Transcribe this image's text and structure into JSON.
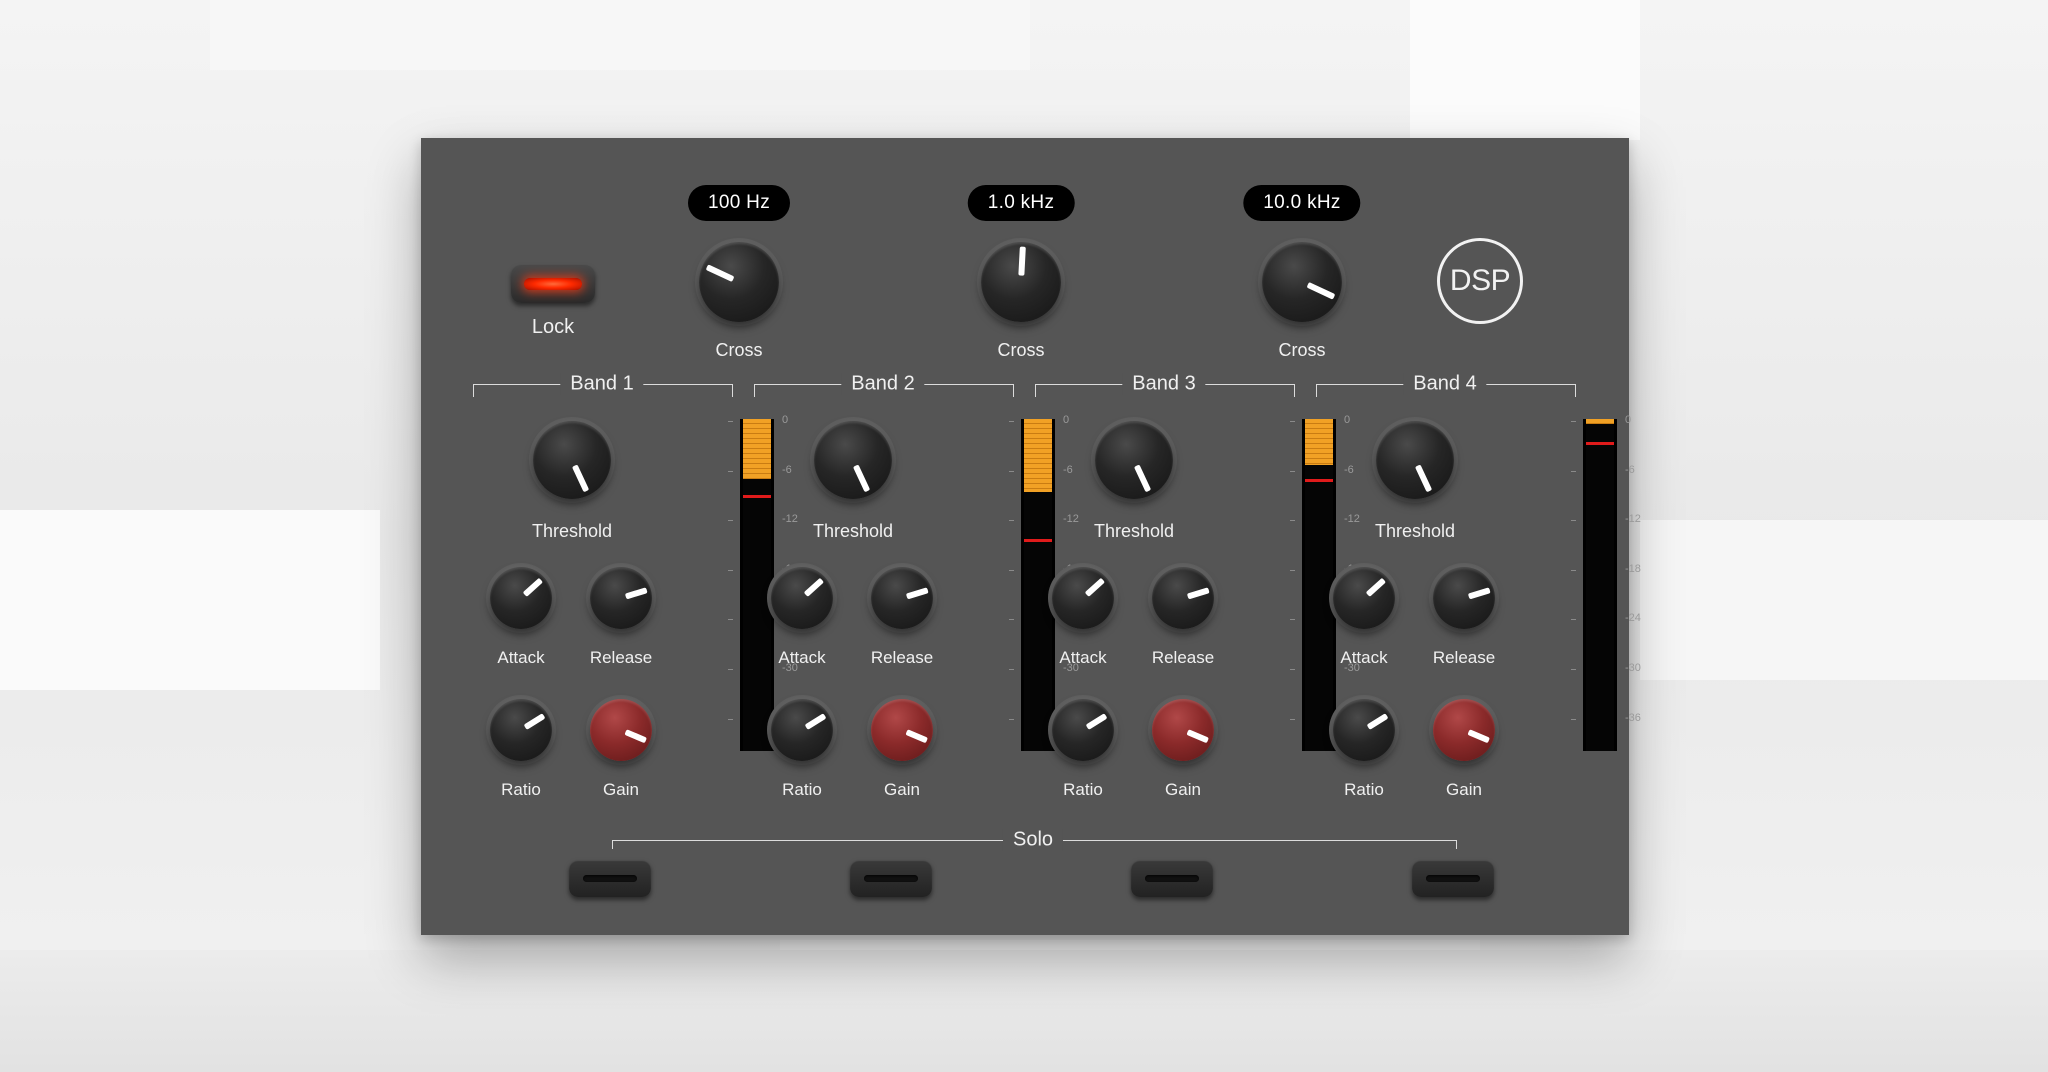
{
  "cross": [
    {
      "label": "Cross",
      "value": "100 Hz",
      "angle": -65
    },
    {
      "label": "Cross",
      "value": "1.0 kHz",
      "angle": 3
    },
    {
      "label": "Cross",
      "value": "10.0 kHz",
      "angle": 115
    }
  ],
  "lock": {
    "label": "Lock",
    "state": "on"
  },
  "logo": {
    "text": "DSP"
  },
  "meter_scale": [
    "0",
    "-6",
    "-12",
    "-18",
    "-24",
    "-30",
    "-36"
  ],
  "bands": [
    {
      "title": "Band 1",
      "threshold": "Threshold",
      "attack": "Attack",
      "release": "Release",
      "ratio": "Ratio",
      "gain": "Gain",
      "threshold_angle": 155,
      "attack_angle": 48,
      "release_angle": 73,
      "ratio_angle": 58,
      "gain_angle": 113,
      "meter": {
        "fill_fraction": 0.18,
        "peak_fraction": 0.23
      }
    },
    {
      "title": "Band 2",
      "threshold": "Threshold",
      "attack": "Attack",
      "release": "Release",
      "ratio": "Ratio",
      "gain": "Gain",
      "threshold_angle": 155,
      "attack_angle": 48,
      "release_angle": 73,
      "ratio_angle": 58,
      "gain_angle": 113,
      "meter": {
        "fill_fraction": 0.22,
        "peak_fraction": 0.36
      }
    },
    {
      "title": "Band 3",
      "threshold": "Threshold",
      "attack": "Attack",
      "release": "Release",
      "ratio": "Ratio",
      "gain": "Gain",
      "threshold_angle": 155,
      "attack_angle": 48,
      "release_angle": 73,
      "ratio_angle": 58,
      "gain_angle": 113,
      "meter": {
        "fill_fraction": 0.14,
        "peak_fraction": 0.18
      }
    },
    {
      "title": "Band 4",
      "threshold": "Threshold",
      "attack": "Attack",
      "release": "Release",
      "ratio": "Ratio",
      "gain": "Gain",
      "threshold_angle": 155,
      "attack_angle": 48,
      "release_angle": 73,
      "ratio_angle": 58,
      "gain_angle": 113,
      "meter": {
        "fill_fraction": 0.015,
        "peak_fraction": 0.07
      }
    }
  ],
  "solo": {
    "title": "Solo",
    "buttons": 4
  },
  "colors": {
    "panel": "#555555",
    "meter_fill": "#f1a125",
    "peak": "#e01b1b",
    "gain_knob": "#8b2a2a",
    "led": "#ff2a00"
  }
}
